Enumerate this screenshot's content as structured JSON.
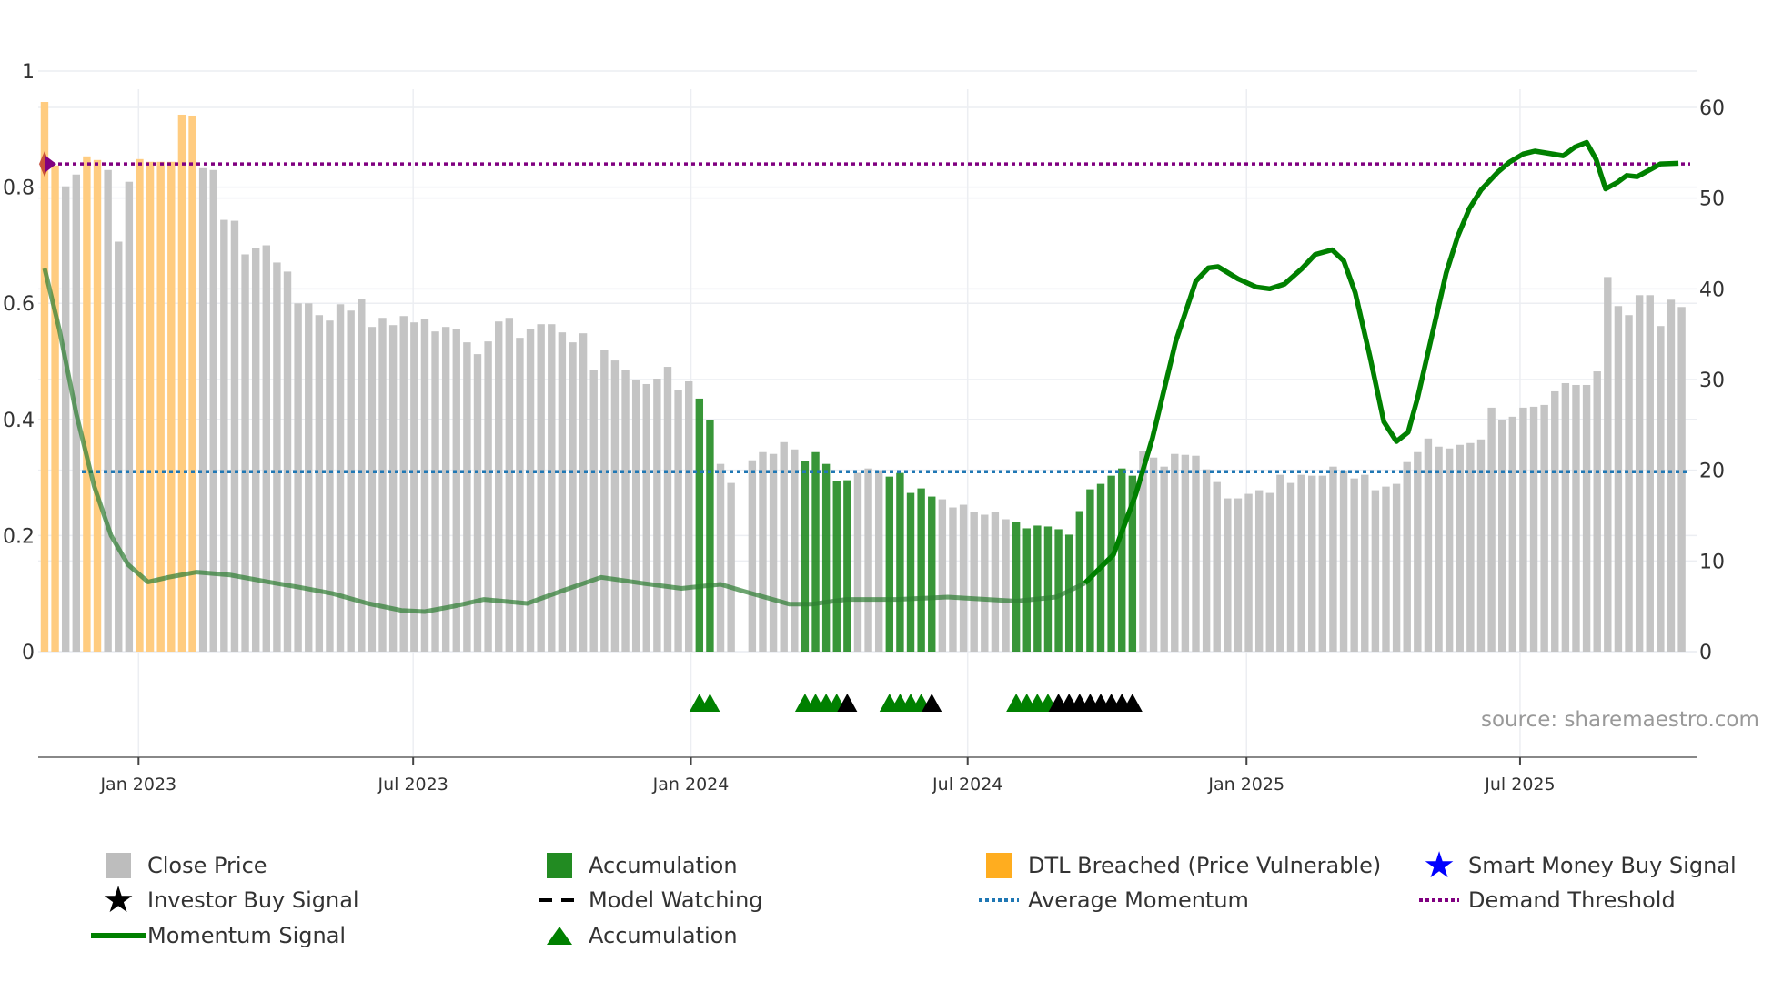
{
  "chart_data": {
    "type": "bar",
    "title": "",
    "xlabel": "",
    "ylabel_left": "",
    "ylabel_right": "",
    "x_unit": "week index",
    "xlim": [
      -0.6,
      156.5
    ],
    "ylim_left": [
      0,
      1
    ],
    "ylim_right": [
      0,
      60
    ],
    "left_ticks": [
      "0",
      "0.2",
      "0.4",
      "0.6",
      "0.8",
      "1"
    ],
    "left_tick_values": [
      0,
      0.2,
      0.4,
      0.6,
      0.8,
      1
    ],
    "right_ticks": [
      "0",
      "10",
      "20",
      "30",
      "40",
      "50",
      "60"
    ],
    "right_tick_values": [
      0,
      10,
      20,
      30,
      40,
      50,
      60
    ],
    "x_ticks": [
      {
        "label": "Jan 2023",
        "x": 8.9
      },
      {
        "label": "Jul 2023",
        "x": 34.9
      },
      {
        "label": "Jan 2024",
        "x": 61.2
      },
      {
        "label": "Jul 2024",
        "x": 87.4
      },
      {
        "label": "Jan 2025",
        "x": 113.8
      },
      {
        "label": "Jul 2025",
        "x": 139.7
      }
    ],
    "grid": true,
    "colors": {
      "price": "#c4c4c4",
      "accumulation": "#228b22",
      "dtl": "#ffcc80",
      "momentum": "#008000",
      "avg_momentum": "#1f77b4",
      "demand": "#800080",
      "marker_green": "#008000",
      "marker_black": "#000000"
    },
    "close_price": {
      "axis": "right",
      "values": [
        60.6,
        53.6,
        51.3,
        52.6,
        54.6,
        54.2,
        53.1,
        45.2,
        51.8,
        54.3,
        54.0,
        54.0,
        54.0,
        59.2,
        59.1,
        53.3,
        53.1,
        47.6,
        47.5,
        43.8,
        44.5,
        44.8,
        42.9,
        41.9,
        38.4,
        38.4,
        37.1,
        36.5,
        38.3,
        37.6,
        38.9,
        35.8,
        36.8,
        36.0,
        37.0,
        36.3,
        36.7,
        35.3,
        35.8,
        35.6,
        34.1,
        32.8,
        34.2,
        36.4,
        36.8,
        34.6,
        35.6,
        36.1,
        36.1,
        35.2,
        34.1,
        35.1,
        31.1,
        33.3,
        32.1,
        31.1,
        29.9,
        29.5,
        30.1,
        31.4,
        28.8,
        29.8,
        27.9,
        25.5,
        20.7,
        18.6,
        null,
        21.1,
        22.0,
        21.8,
        23.1,
        22.3,
        21.0,
        22.0,
        20.7,
        18.8,
        18.9,
        19.7,
        20.2,
        20.0,
        19.3,
        19.7,
        17.5,
        18.0,
        17.1,
        16.8,
        15.9,
        16.2,
        15.4,
        15.1,
        15.4,
        14.6,
        14.3,
        13.6,
        13.9,
        13.8,
        13.5,
        12.9,
        15.5,
        17.9,
        18.5,
        19.4,
        20.2,
        19.4,
        22.1,
        21.4,
        20.4,
        21.8,
        21.7,
        21.6,
        20.1,
        18.7,
        16.9,
        16.9,
        17.4,
        17.8,
        17.5,
        19.5,
        18.6,
        19.5,
        19.4,
        19.4,
        20.4,
        19.9,
        19.1,
        19.5,
        17.8,
        18.2,
        18.5,
        20.9,
        22.0,
        23.5,
        22.6,
        22.4,
        22.8,
        23.0,
        23.4,
        26.9,
        25.5,
        25.9,
        26.9,
        27.0,
        27.2,
        28.7,
        29.6,
        29.4,
        29.4,
        30.9,
        41.3,
        38.1,
        37.1,
        39.3,
        39.3,
        35.9,
        38.8,
        38.0
      ],
      "dtl_breached_indices": [
        0,
        1,
        4,
        5,
        9,
        10,
        11,
        12,
        13,
        14
      ],
      "accumulation_indices": [
        62,
        63,
        72,
        73,
        74,
        75,
        76,
        80,
        81,
        82,
        83,
        84,
        92,
        93,
        94,
        95,
        96,
        97,
        98,
        99,
        100,
        101,
        102,
        103
      ]
    },
    "momentum_signal": {
      "axis": "left",
      "emphasis_from_x": 101,
      "x": [
        0,
        1.4,
        3.0,
        4.7,
        6.3,
        7.9,
        9.8,
        11.7,
        14.4,
        17.6,
        20.9,
        24.1,
        27.3,
        30.6,
        33.8,
        36.0,
        38.7,
        41.6,
        45.7,
        48.9,
        52.7,
        56.5,
        60.3,
        64.0,
        66.2,
        70.5,
        72.7,
        75.9,
        80.7,
        85.5,
        92.0,
        95.8,
        98.5,
        101.2,
        103.3,
        104.9,
        107.1,
        109.0,
        110.2,
        111.1,
        113.0,
        114.7,
        116.0,
        117.4,
        119.0,
        120.3,
        121.9,
        123.0,
        124.1,
        125.5,
        126.8,
        128.0,
        129.1,
        130.0,
        131.4,
        132.7,
        133.8,
        134.9,
        136.0,
        137.6,
        138.7,
        140.0,
        141.1,
        143.8,
        144.9,
        146.0,
        146.9,
        147.8,
        148.9,
        149.8,
        150.8,
        151.9,
        153.0,
        154.7
      ],
      "y": [
        0.66,
        0.555,
        0.41,
        0.285,
        0.2,
        0.15,
        0.12,
        0.128,
        0.137,
        0.132,
        0.121,
        0.111,
        0.1,
        0.083,
        0.071,
        0.069,
        0.078,
        0.09,
        0.083,
        0.104,
        0.128,
        0.118,
        0.109,
        0.116,
        0.104,
        0.082,
        0.082,
        0.09,
        0.09,
        0.094,
        0.087,
        0.094,
        0.118,
        0.167,
        0.27,
        0.368,
        0.534,
        0.638,
        0.661,
        0.663,
        0.642,
        0.628,
        0.625,
        0.633,
        0.659,
        0.684,
        0.692,
        0.673,
        0.618,
        0.507,
        0.396,
        0.362,
        0.378,
        0.437,
        0.548,
        0.652,
        0.715,
        0.763,
        0.795,
        0.826,
        0.843,
        0.857,
        0.862,
        0.854,
        0.869,
        0.877,
        0.848,
        0.797,
        0.808,
        0.82,
        0.818,
        0.829,
        0.84,
        0.841
      ]
    },
    "average_momentum": {
      "axis": "left",
      "value": 0.31
    },
    "demand_threshold": {
      "axis": "left",
      "value": 0.84
    },
    "start_marker": {
      "x": 0,
      "y": 0.84
    },
    "signal_markers": {
      "green": [
        62,
        63,
        72,
        73,
        74,
        75,
        80,
        81,
        82,
        83,
        92,
        93,
        94,
        95
      ],
      "black": [
        76,
        84,
        96,
        97,
        98,
        99,
        100,
        101,
        102,
        103
      ]
    },
    "source": "source: sharemaestro.com",
    "legend": [
      {
        "label": "Close Price",
        "icon": "gray-square"
      },
      {
        "label": "Accumulation",
        "icon": "green-square"
      },
      {
        "label": "DTL Breached (Price Vulnerable)",
        "icon": "orange-square"
      },
      {
        "label": "Smart Money Buy Signal",
        "icon": "blue-star"
      },
      {
        "label": "Investor Buy Signal",
        "icon": "black-star"
      },
      {
        "label": "Model Watching",
        "icon": "black-dashed-line"
      },
      {
        "label": "Average Momentum",
        "icon": "blue-dotted-line"
      },
      {
        "label": "Demand Threshold",
        "icon": "purple-dotted-line"
      },
      {
        "label": "Momentum Signal",
        "icon": "green-line"
      },
      {
        "label": "Accumulation",
        "icon": "green-triangle"
      }
    ],
    "legend_position": "bottom"
  }
}
